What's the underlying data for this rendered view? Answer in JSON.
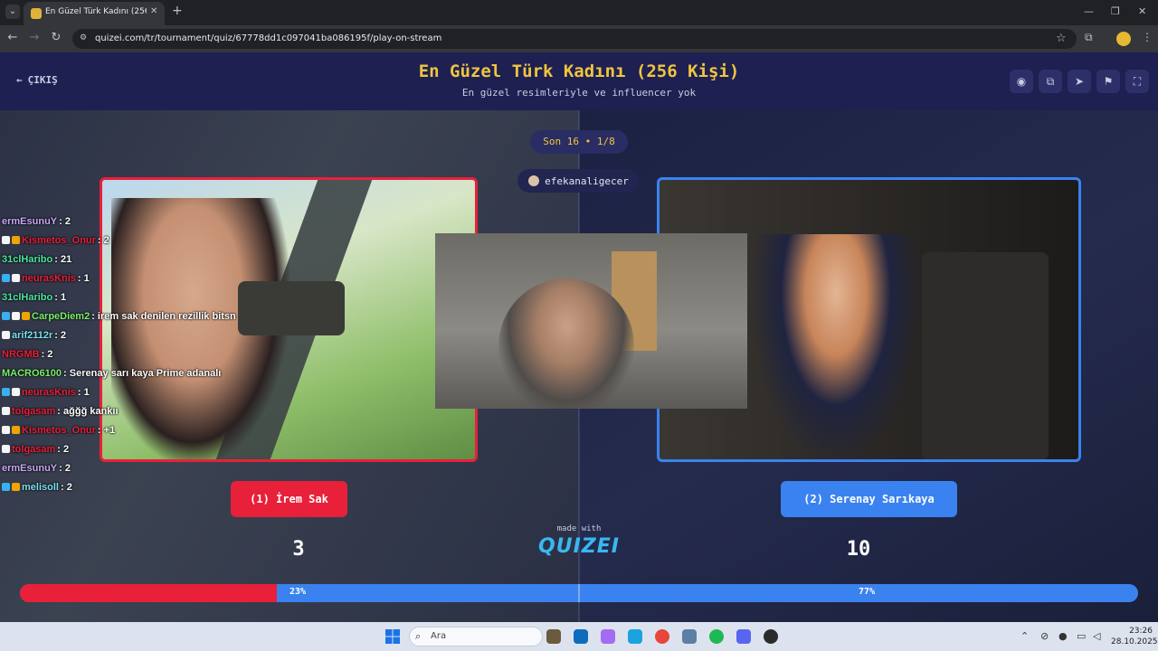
{
  "browser": {
    "tab_title": "En Güzel Türk Kadını (256 Kişi)",
    "url": "quizei.com/tr/tournament/quiz/67778dd1c097041ba086195f/play-on-stream"
  },
  "header": {
    "exit_label": "ÇIKIŞ",
    "title": "En Güzel Türk Kadını (256 Kişi)",
    "subtitle": "En güzel resimleriyle ve influencer yok",
    "actions": [
      "eye-icon",
      "copy-icon",
      "send-icon",
      "flag-icon",
      "fullscreen-icon"
    ]
  },
  "round": {
    "label": "Son 16 • 1/8",
    "streamer": "efekanaligecer"
  },
  "candidates": {
    "left": {
      "label": "(1) İrem Sak",
      "score": "3",
      "percent": "23%",
      "percent_value": 23,
      "color": "#e8203a"
    },
    "right": {
      "label": "(2) Serenay Sarıkaya",
      "score": "10",
      "percent": "77%",
      "percent_value": 77,
      "color": "#3a82f0"
    }
  },
  "branding": {
    "made_with": "made with",
    "logo": "QUIZEI"
  },
  "chat": [
    {
      "user": "ermEsunuY",
      "color": "#c9a7f5",
      "text": ": 2",
      "badges": []
    },
    {
      "user": "Kismetos_Onur",
      "color": "#e8203a",
      "text": ": 2",
      "badges": [
        "#f5f5f5",
        "#f0a400"
      ]
    },
    {
      "user": "31clHaribo",
      "color": "#4ce6a0",
      "text": ": 21",
      "badges": []
    },
    {
      "user": "neurasKnis",
      "color": "#e8203a",
      "text": ": 1",
      "badges": [
        "#3ab0f0",
        "#f5f5f5"
      ]
    },
    {
      "user": "31clHaribo",
      "color": "#4ce6a0",
      "text": ": 1",
      "badges": []
    },
    {
      "user": "CarpeDiem2",
      "color": "#7bf06a",
      "text": ": irem sak denilen rezillik bitsn",
      "badges": [
        "#3ab0f0",
        "#f5f5f5",
        "#f0a400"
      ]
    },
    {
      "user": "arif2112r",
      "color": "#7be0f0",
      "text": ": 2",
      "badges": [
        "#f5f5f5"
      ]
    },
    {
      "user": "NRGMB",
      "color": "#e8203a",
      "text": ": 2",
      "badges": []
    },
    {
      "user": "MACRO6100",
      "color": "#7bf06a",
      "text": ": Serenay sarı kaya Prime adanalı",
      "badges": []
    },
    {
      "user": "neurasKnis",
      "color": "#e8203a",
      "text": ": 1",
      "badges": [
        "#3ab0f0",
        "#f5f5f5"
      ]
    },
    {
      "user": "tolgasam",
      "color": "#e8203a",
      "text": ": ağğğ kankıı",
      "badges": [
        "#f5f5f5"
      ]
    },
    {
      "user": "Kismetos_Onur",
      "color": "#e8203a",
      "text": ": +1",
      "badges": [
        "#f5f5f5",
        "#f0a400"
      ]
    },
    {
      "user": "tolgasam",
      "color": "#e8203a",
      "text": ": 2",
      "badges": [
        "#f5f5f5"
      ]
    },
    {
      "user": "ermEsunuY",
      "color": "#c9a7f5",
      "text": ": 2",
      "badges": []
    },
    {
      "user": "melisoll",
      "color": "#7be0f0",
      "text": ": 2",
      "badges": [
        "#3ab0f0",
        "#f0a400"
      ]
    }
  ],
  "taskbar": {
    "search_placeholder": "Ara",
    "time": "23:26",
    "date": "28.10.2025"
  }
}
